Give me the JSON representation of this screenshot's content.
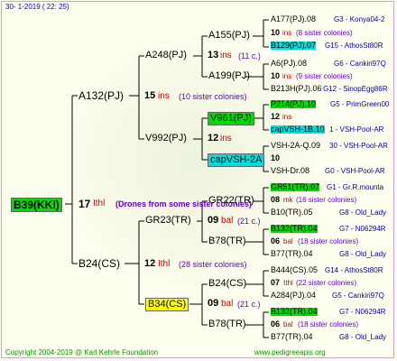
{
  "header": {
    "date": "30-   1-2019  (  22:  25)"
  },
  "footer": {
    "copyright": "Copyright 2004-2019 @ Karl Kehrle Foundation",
    "site": "www.pedigreeapis.org"
  },
  "root": {
    "label": "B39(KKI)",
    "num": "17",
    "ins": "Ithl",
    "note": "(Drones from some sister colonies)"
  },
  "gen1": {
    "a132": {
      "label": "A132(PJ)",
      "num": "15",
      "ins": "ins",
      "sis": "(10 sister colonies)"
    },
    "b24": {
      "label": "B24(CS)",
      "num": "12",
      "ins": "Ithl",
      "sis": "(28 sister colonies)"
    }
  },
  "gen2": {
    "a248": {
      "label": "A248(PJ)",
      "num": "13",
      "ins": "ins",
      "sis": "(11 c.)"
    },
    "v992": {
      "label": "V992(PJ)",
      "num": "12",
      "ins": "ins"
    },
    "gr23": {
      "label": "GR23(TR)",
      "num": "09",
      "ins": "bal",
      "sis": "(21 c.)"
    },
    "b34": {
      "label": "B34(CS)",
      "num": "09",
      "ins": "bal",
      "sis": "(21 c.)"
    }
  },
  "gen3": {
    "a155": "A155(PJ)",
    "a199": "A199(PJ)",
    "v961": "V961(PJ)",
    "capvsh": "capVSH-2A",
    "gr22": "GR22(TR)",
    "b78a": "B78(TR)",
    "b24cs": "B24(CS)",
    "b78b": "B78(TR)"
  },
  "gen4": {
    "r1": {
      "label": "A177(PJ).08",
      "info": "G3 - Konya04-2"
    },
    "r2": {
      "num": "10",
      "ins": "ins",
      "sis": "(8 sister colonies)"
    },
    "r3": {
      "label": "B129(PJ).07",
      "info": "G15 - AthosSt80R"
    },
    "r4": {
      "label": "A6(PJ).08",
      "info": "G6 - Cankiri97Q"
    },
    "r5": {
      "num": "10",
      "ins": "ins",
      "sis": "(9 sister colonies)"
    },
    "r6": {
      "label": "B213H(PJ).06",
      "info": "G12 - SinopEgg86R"
    },
    "r7": {
      "label": "P214(PJ).10",
      "info": "G5 - PrimGreen00"
    },
    "r8": {
      "num": "12",
      "ins": "ins"
    },
    "r9": {
      "label": "capVSH-1B.10",
      "info": "1 - VSH-Pool-AR"
    },
    "r10": {
      "label": "VSH-2A-Q.09",
      "info": "30 - VSH-Pool-AR"
    },
    "r11": {
      "num": "10"
    },
    "r12": {
      "label": "VSH-Dr.08",
      "info": "G0 - VSH-Pool-AR"
    },
    "r13": {
      "label": "GR51(TR).07",
      "info": "G1 - Gr.R.mounta"
    },
    "r14": {
      "num": "08",
      "ins": "mk",
      "sis": "(16 sister colonies)"
    },
    "r15": {
      "label": "B10(TR).05",
      "info": "G8 - Old_Lady"
    },
    "r16": {
      "label": "B132(TR).04",
      "info": "G7 - N06294R"
    },
    "r17": {
      "num": "06",
      "ins": "bal",
      "sis": "(18 sister colonies)"
    },
    "r18": {
      "label": "B77(TR).04",
      "info": "G8 - Old_Lady"
    },
    "r19": {
      "label": "B444(CS).05",
      "info": "G14 - AthosSt80R"
    },
    "r20": {
      "num": "07",
      "ins": "Ithl",
      "sis": "(22 sister colonies)"
    },
    "r21": {
      "label": "A284(PJ).04",
      "info": "G5 - Cankiri97Q"
    },
    "r22": {
      "label": "B132(TR).04",
      "info": "G7 - N06294R"
    },
    "r23": {
      "num": "06",
      "ins": "bal",
      "sis": "(18 sister colonies)"
    },
    "r24": {
      "label": "B77(TR).04",
      "info": "G8 - Old_Lady"
    }
  },
  "colors": {
    "green": "#00dd00",
    "cyan": "#00dddd",
    "yellow": "#ffff00",
    "ins": "#cc0000",
    "sister": "#6600cc",
    "info": "#0000aa"
  }
}
